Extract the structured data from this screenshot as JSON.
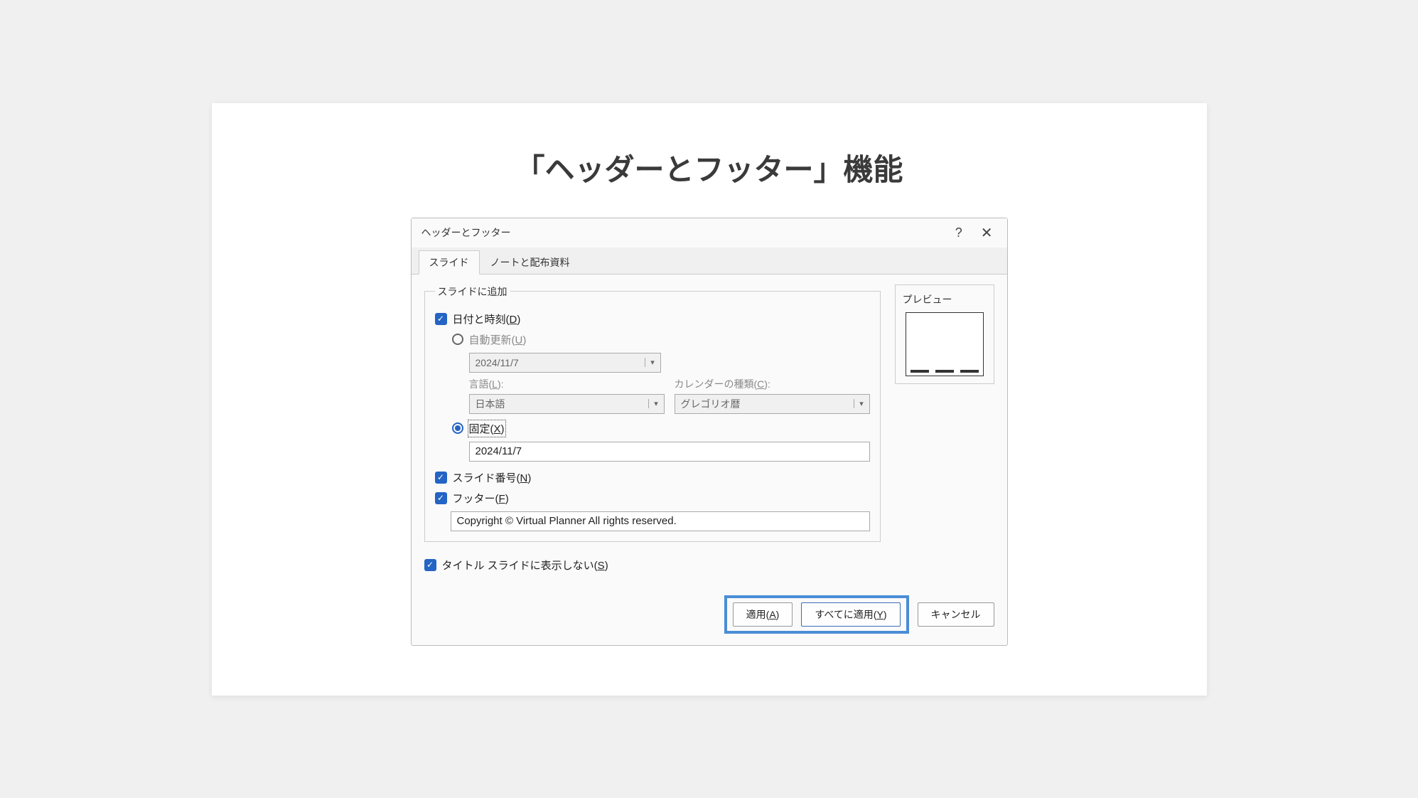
{
  "slide": {
    "title": "「ヘッダーとフッター」機能"
  },
  "dialog": {
    "title": "ヘッダーとフッター",
    "help": "?",
    "close": "✕",
    "tabs": {
      "slide": "スライド",
      "notes": "ノートと配布資料"
    },
    "group": {
      "addToSlide": "スライドに追加",
      "preview": "プレビュー"
    },
    "dateTime": {
      "label": "日付と時刻",
      "hotkey": "D",
      "autoUpdate": {
        "label": "自動更新",
        "hotkey": "U"
      },
      "dateValue": "2024/11/7",
      "language": {
        "label": "言語",
        "hotkey": "L",
        "value": "日本語"
      },
      "calendar": {
        "label": "カレンダーの種類",
        "hotkey": "C",
        "value": "グレゴリオ暦"
      },
      "fixed": {
        "label": "固定",
        "hotkey": "X",
        "value": "2024/11/7"
      }
    },
    "slideNumber": {
      "label": "スライド番号",
      "hotkey": "N"
    },
    "footer": {
      "label": "フッター",
      "hotkey": "F",
      "value": "Copyright © Virtual Planner All rights reserved."
    },
    "hideOnTitle": {
      "label": "タイトル スライドに表示しない",
      "hotkey": "S"
    },
    "buttons": {
      "apply": {
        "label": "適用",
        "hotkey": "A"
      },
      "applyAll": {
        "label": "すべてに適用",
        "hotkey": "Y"
      },
      "cancel": "キャンセル"
    }
  }
}
